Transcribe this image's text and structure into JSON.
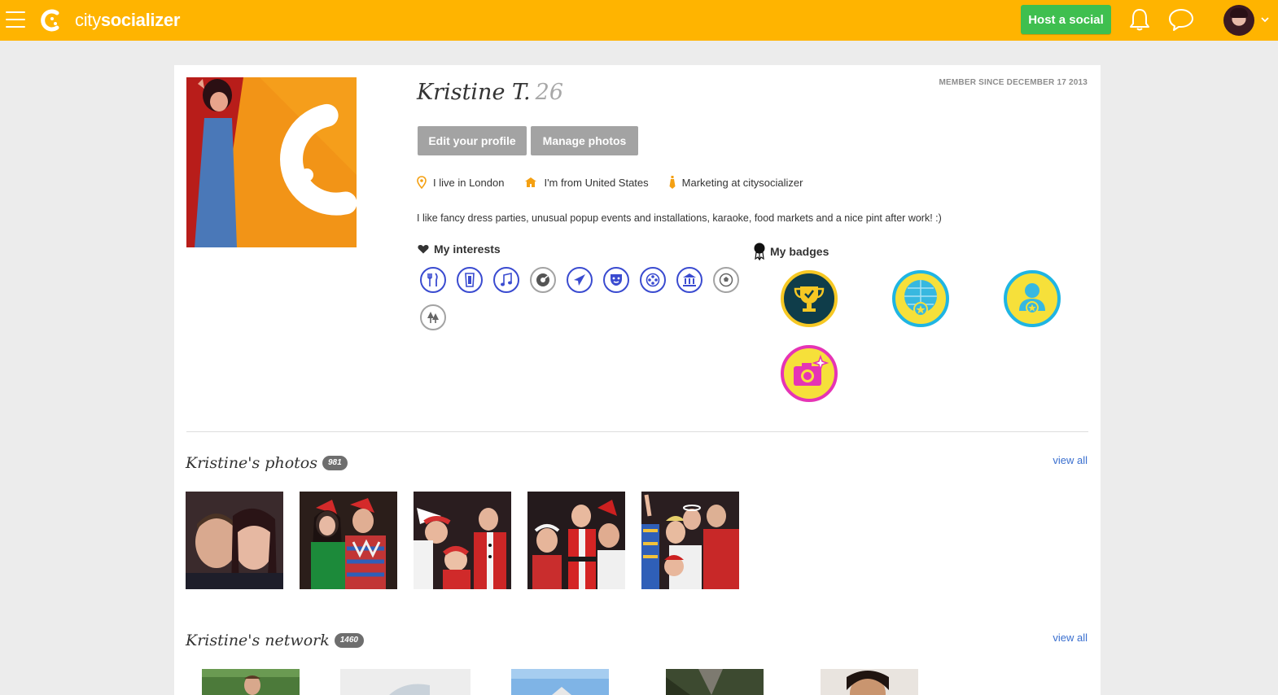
{
  "header": {
    "logo_text_light": "city",
    "logo_text_bold": "socializer",
    "host_button": "Host a social"
  },
  "profile": {
    "name": "Kristine T.",
    "age": "26",
    "member_since": "MEMBER SINCE DECEMBER 17 2013",
    "edit_button": "Edit your profile",
    "photos_button": "Manage photos",
    "lives_in": "I live in London",
    "from": "I'm from United States",
    "job": "Marketing at citysocializer",
    "bio": "I like fancy dress parties, unusual popup events and installations, karaoke, food markets and a nice pint after work! :)",
    "interests_label": "My interests",
    "badges_label": "My badges",
    "interests": [
      {
        "icon": "fork-knife-icon",
        "active": true
      },
      {
        "icon": "beer-glass-icon",
        "active": true
      },
      {
        "icon": "music-note-icon",
        "active": true
      },
      {
        "icon": "vinyl-record-icon",
        "active": false
      },
      {
        "icon": "airplane-icon",
        "active": true
      },
      {
        "icon": "theatre-mask-icon",
        "active": true
      },
      {
        "icon": "film-reel-icon",
        "active": true
      },
      {
        "icon": "museum-icon",
        "active": true
      },
      {
        "icon": "football-icon",
        "active": false
      },
      {
        "icon": "trees-icon",
        "active": false
      }
    ],
    "badges": [
      {
        "icon": "trophy-badge-icon",
        "bg": "#0f3d4a",
        "ring": "#f6c824"
      },
      {
        "icon": "disco-ball-badge-icon",
        "bg": "#f6e03a",
        "ring": "#1fb5e3"
      },
      {
        "icon": "person-star-badge-icon",
        "bg": "#f6e03a",
        "ring": "#1fb5e3"
      },
      {
        "icon": "camera-badge-icon",
        "bg": "#f6e03a",
        "ring": "#e534b5"
      }
    ]
  },
  "photos": {
    "title": "Kristine's photos",
    "count": "981",
    "view_all": "view all"
  },
  "network": {
    "title": "Kristine's network",
    "count": "1460",
    "view_all": "view all"
  },
  "colors": {
    "brand_yellow": "#ffb400",
    "host_green": "#3fbf4f",
    "interest_blue": "#3a4bd0",
    "link_blue": "#3a6fcf"
  }
}
